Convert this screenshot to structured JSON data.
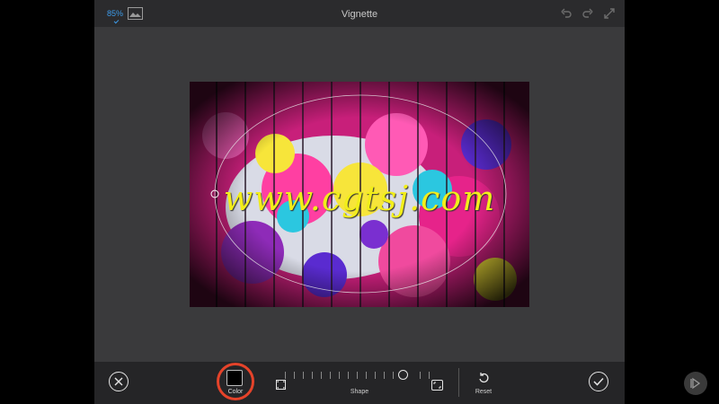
{
  "topbar": {
    "zoom": "85%",
    "title": "Vignette",
    "icons": [
      "image-icon",
      "undo-icon",
      "redo-icon",
      "fullscreen-icon"
    ]
  },
  "canvas": {
    "watermark": "www.cgtsj.com"
  },
  "bottombar": {
    "color_label": "Color",
    "color_value": "#000000",
    "shape_label": "Shape",
    "shape_level": 0.77,
    "reset_label": "Reset",
    "icons": [
      "cancel-icon",
      "square-corners-icon",
      "round-corners-icon",
      "reset-icon",
      "checkmark-icon"
    ]
  },
  "colors": {
    "accent": "#3d9be9",
    "highlight_ring": "#e5432a",
    "panel": "#3a3a3c",
    "bar": "#252527"
  },
  "player": {
    "icon": "play-icon"
  }
}
